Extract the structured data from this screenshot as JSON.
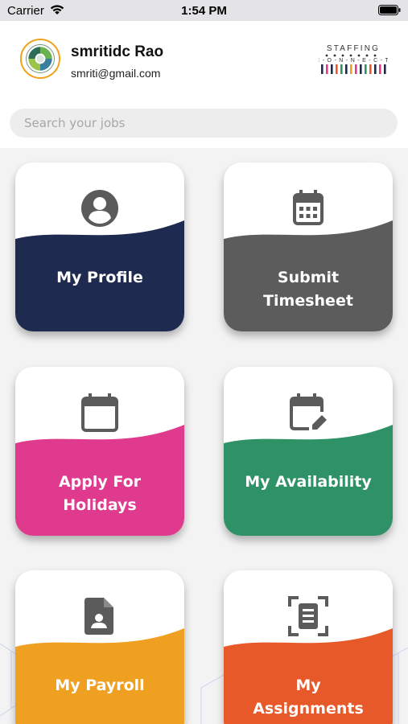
{
  "status_bar": {
    "carrier": "Carrier",
    "time": "1:54 PM",
    "icons": [
      "wifi-icon",
      "battery-icon"
    ]
  },
  "header": {
    "user_name": "smritidc Rao",
    "user_email": "smriti@gmail.com",
    "logo": {
      "top_text": "STAFFING",
      "bottom_text": "C O N N E C T"
    }
  },
  "search": {
    "placeholder": "Search your jobs"
  },
  "tiles": [
    {
      "id": "profile",
      "line1": "My Profile",
      "line2": "",
      "color": "#1e2a4f",
      "icon": "account-circle-icon"
    },
    {
      "id": "timesheet",
      "line1": "Submit",
      "line2": "Timesheet",
      "color": "#5c5c5c",
      "icon": "calendar-grid-icon"
    },
    {
      "id": "holidays",
      "line1": "Apply For",
      "line2": "Holidays",
      "color": "#e03a8e",
      "icon": "calendar-blank-icon"
    },
    {
      "id": "availability",
      "line1": "My Availability",
      "line2": "",
      "color": "#2e9266",
      "icon": "calendar-edit-icon"
    },
    {
      "id": "payroll",
      "line1": "My Payroll",
      "line2": "",
      "color": "#f0a021",
      "icon": "payroll-document-icon"
    },
    {
      "id": "assignments",
      "line1": "My",
      "line2": "Assignments",
      "color": "#e8592a",
      "icon": "document-scan-icon"
    }
  ]
}
